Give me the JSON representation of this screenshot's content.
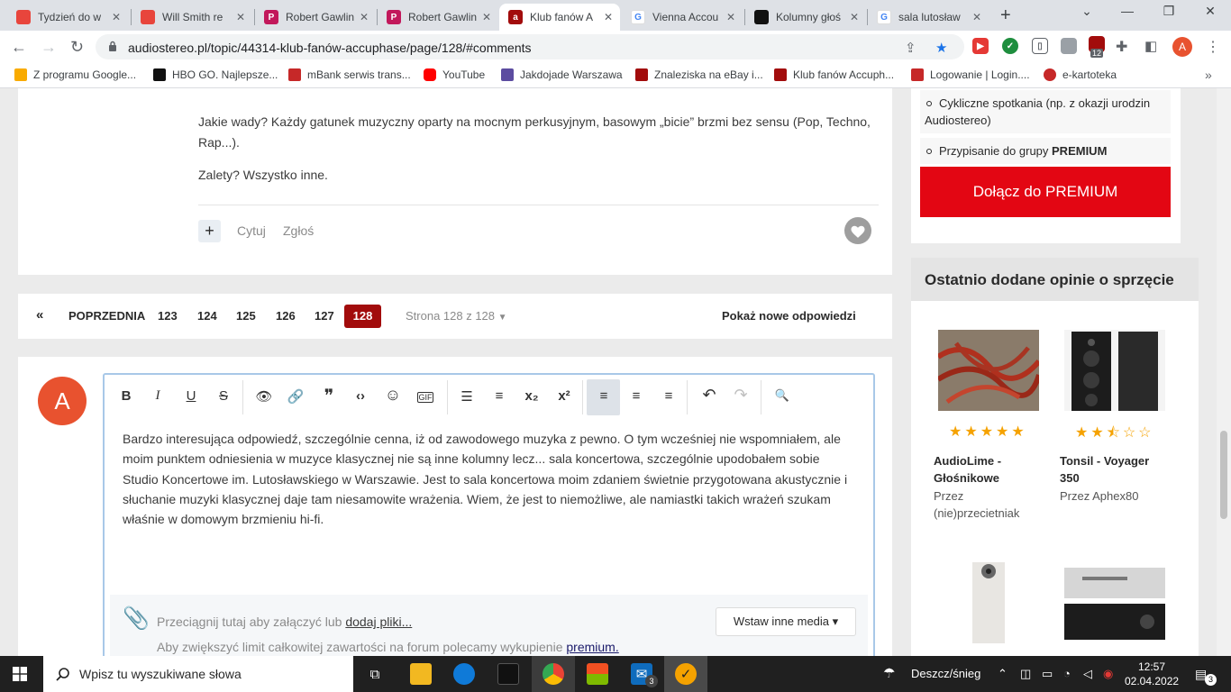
{
  "browser": {
    "tabs": [
      {
        "label": "Tydzień do w",
        "fav": "#e8453c",
        "active": false
      },
      {
        "label": "Will Smith re",
        "fav": "#e8453c",
        "active": false
      },
      {
        "label": "Robert Gawlin",
        "fav": "#c2185b",
        "active": false
      },
      {
        "label": "Robert Gawlin",
        "fav": "#c2185b",
        "active": false
      },
      {
        "label": "Klub fanów A",
        "fav": "#a20c0c",
        "active": true
      },
      {
        "label": "Vienna Accou",
        "fav": "#4285f4",
        "active": false
      },
      {
        "label": "Kolumny głoś",
        "fav": "#111111",
        "active": false
      },
      {
        "label": "sala lutosław",
        "fav": "#4285f4",
        "active": false
      }
    ],
    "tab_close": "✕",
    "new_tab": "+",
    "win_controls": {
      "chevron": "⌄",
      "minimize": "—",
      "restore": "❐",
      "close": "✕"
    },
    "url": "audiostereo.pl/topic/44314-klub-fanów-accuphase/page/128/#comments",
    "extension_badge": "12",
    "profile_initial": "A",
    "bookmarks": [
      {
        "label": "Z programu Google...",
        "color": "#f9ab00"
      },
      {
        "label": "HBO GO. Najlepsze...",
        "color": "#111111"
      },
      {
        "label": "mBank serwis trans...",
        "color": "#c62828"
      },
      {
        "label": "YouTube",
        "color": "#ff0000"
      },
      {
        "label": "Jakdojade Warszawa",
        "color": "#5c4ca0"
      },
      {
        "label": "Znaleziska na eBay i...",
        "color": "#a20c0c"
      },
      {
        "label": "Klub fanów Accuph...",
        "color": "#a20c0c"
      },
      {
        "label": "Logowanie | Login....",
        "color": "#c62828"
      },
      {
        "label": "e-kartoteka",
        "color": "#c62828"
      }
    ],
    "bookmarks_more": "»"
  },
  "post": {
    "paragraph1": "Jakie wady? Każdy gatunek muzyczny oparty na mocnym perkusyjnym, basowym „bicie” brzmi bez sensu (Pop, Techno, Rap...).",
    "paragraph2": "Zalety? Wszystko inne.",
    "plus": "+",
    "quote": "Cytuj",
    "report": "Zgłoś"
  },
  "pagination": {
    "prev_icon": "«",
    "prev": "POPRZEDNIA",
    "pages": [
      "123",
      "124",
      "125",
      "126",
      "127"
    ],
    "current": "128",
    "status": "Strona 128 z 128",
    "show_new": "Pokaż nowe odpowiedzi"
  },
  "reply": {
    "avatar_initial": "A",
    "text": "Bardzo interesująca odpowiedź, szczególnie cenna, iż od zawodowego muzyka z pewno. O tym wcześniej nie wspomniałem, ale moim punktem odniesienia w muzyce klasycznej nie są inne kolumny lecz... sala koncertowa, szczególnie upodobałem sobie Studio Koncertowe im. Lutosławskiego w Warszawie. Jest to sala koncertowa moim zdaniem świetnie przygotowana akustycznie i słuchanie muzyki klasycznej daje tam niesamowite wrażenia. Wiem, że jest to niemożliwe, ale namiastki takich wrażeń szukam właśnie w domowym brzmieniu hi-fi.",
    "attach_text": "Przeciągnij tutaj aby załączyć lub ",
    "attach_link": "dodaj pliki...",
    "limit_text": "Aby zwiększyć limit całkowitej zawartości na forum polecamy wykupienie ",
    "limit_link": "premium.",
    "media_button": "Wstaw inne media ▾"
  },
  "toolbar_buttons": [
    {
      "name": "bold-button",
      "glyph": "B"
    },
    {
      "name": "italic-button",
      "glyph": "I"
    },
    {
      "name": "underline-button",
      "glyph": "U"
    },
    {
      "name": "strikethrough-button",
      "glyph": "S"
    },
    {
      "name": "spoiler-button",
      "glyph": "👁"
    },
    {
      "name": "link-button",
      "glyph": "🔗"
    },
    {
      "name": "quote-button",
      "glyph": "❞"
    },
    {
      "name": "code-button",
      "glyph": "‹›"
    },
    {
      "name": "emoji-button",
      "glyph": "☺"
    },
    {
      "name": "gif-button",
      "glyph": "GIF"
    },
    {
      "name": "bullet-list-button",
      "glyph": "☰"
    },
    {
      "name": "numbered-list-button",
      "glyph": "≡"
    },
    {
      "name": "subscript-button",
      "glyph": "x₂"
    },
    {
      "name": "superscript-button",
      "glyph": "x²"
    },
    {
      "name": "align-left-button",
      "glyph": "≡"
    },
    {
      "name": "align-center-button",
      "glyph": "≡"
    },
    {
      "name": "align-right-button",
      "glyph": "≡"
    },
    {
      "name": "undo-button",
      "glyph": "↶"
    },
    {
      "name": "redo-button",
      "glyph": "↷"
    },
    {
      "name": "preview-button",
      "glyph": "🔍"
    }
  ],
  "sidebar": {
    "premium_items": [
      "Cykliczne spotkania (np. z okazji urodzin Audiostereo)"
    ],
    "premium_item2_prefix": "Przypisanie do grupy ",
    "premium_item2_bold": "PREMIUM",
    "premium_button": "Dołącz do PREMIUM",
    "reviews_title": "Ostatnio dodane opinie o sprzęcie",
    "reviews": [
      {
        "name": "AudioLime - Głośnikowe",
        "by": "Przez (nie)przecietniak",
        "rating": 5,
        "stars": "★★★★★"
      },
      {
        "name": "Tonsil - Voyager 350",
        "by": "Przez Aphex80",
        "rating": 2.5,
        "stars": "★★⯪☆☆"
      }
    ]
  },
  "taskbar": {
    "search_placeholder": "Wpisz tu wyszukiwane słowa",
    "weather": "Deszcz/śnieg",
    "time": "12:57",
    "date": "02.04.2022",
    "mail_badge": "3",
    "notif_badge": "3"
  }
}
